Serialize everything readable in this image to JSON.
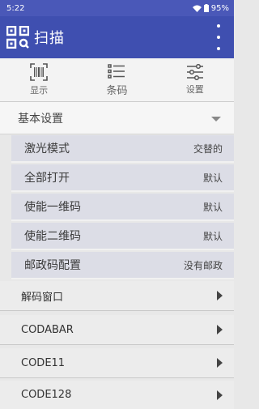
{
  "status_bar": {
    "time": "5:22",
    "battery": "95%"
  },
  "app_bar": {
    "title": "扫描",
    "icon": "qr-scan-icon",
    "menu_icon": "overflow-menu-icon"
  },
  "tabs": [
    {
      "label": "显示",
      "icon": "barcode-display-icon"
    },
    {
      "label": "条码",
      "icon": "list-icon"
    },
    {
      "label": "设置",
      "icon": "sliders-icon"
    }
  ],
  "section": {
    "title": "基本设置"
  },
  "settings": [
    {
      "label": "激光模式",
      "value": "交替的"
    },
    {
      "label": "全部打开",
      "value": "默认"
    },
    {
      "label": "使能一维码",
      "value": "默认"
    },
    {
      "label": "使能二维码",
      "value": "默认"
    },
    {
      "label": "邮政码配置",
      "value": "没有邮政"
    }
  ],
  "list": [
    {
      "label": "解码窗口"
    },
    {
      "label": "CODABAR"
    },
    {
      "label": "CODE11"
    },
    {
      "label": "CODE128"
    }
  ],
  "colors": {
    "app_bar": "#3f4fb0",
    "status_bar": "#4a58b8"
  }
}
